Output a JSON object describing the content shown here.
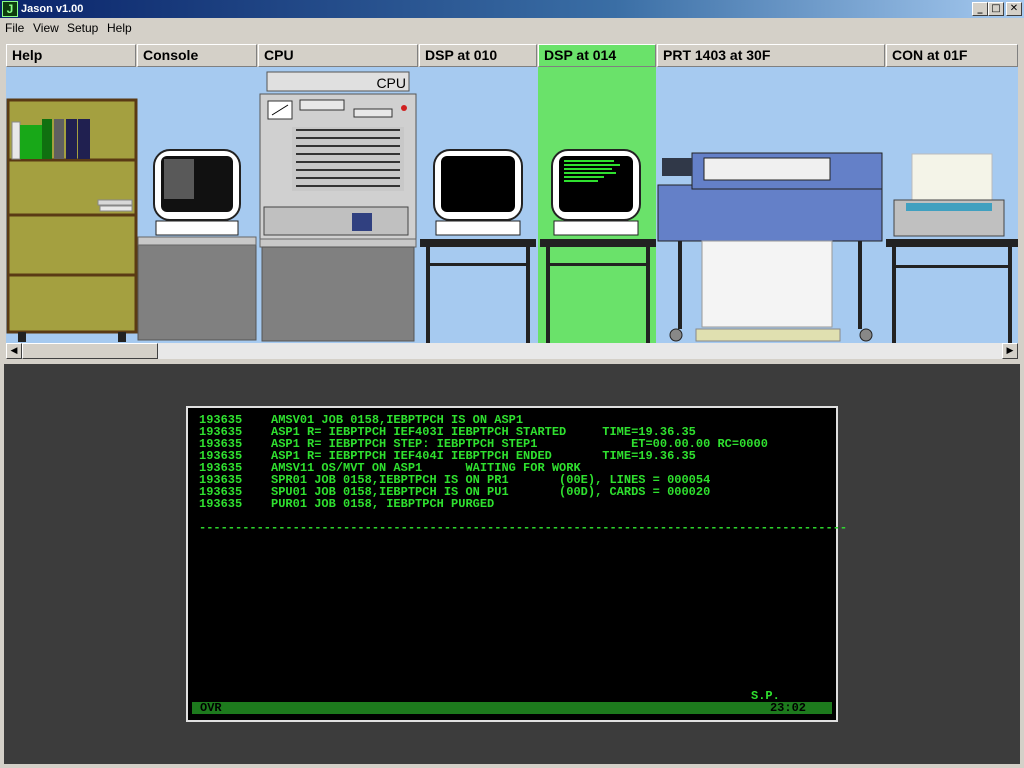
{
  "window": {
    "title": "Jason v1.00",
    "app_icon_glyph": "J",
    "minimize": "_",
    "maximize": "□",
    "close": "✕"
  },
  "menu": {
    "items": [
      "File",
      "View",
      "Setup",
      "Help"
    ]
  },
  "tabs": [
    {
      "label": "Help"
    },
    {
      "label": "Console"
    },
    {
      "label": "CPU"
    },
    {
      "label": "DSP at 010"
    },
    {
      "label": "DSP at 014",
      "active": true
    },
    {
      "label": "PRT 1403 at 30F"
    },
    {
      "label": "CON at 01F"
    }
  ],
  "machine_room": {
    "cpu_label": "CPU"
  },
  "scrollbar": {
    "left_arrow": "◀",
    "right_arrow": "▶"
  },
  "terminal": {
    "lines": [
      "193635    AMSV01 JOB 0158,IEBPTPCH IS ON ASP1",
      "193635    ASP1 R= IEBPTPCH IEF403I IEBPTPCH STARTED     TIME=19.36.35",
      "193635    ASP1 R= IEBPTPCH STEP: IEBPTPCH STEP1             ET=00.00.00 RC=0000",
      "193635    ASP1 R= IEBPTPCH IEF404I IEBPTPCH ENDED       TIME=19.36.35",
      "193635    AMSV11 OS/MVT ON ASP1      WAITING FOR WORK",
      "193635    SPR01 JOB 0158,IEBPTPCH IS ON PR1       (00E), LINES = 000054",
      "193635    SPU01 JOB 0158,IEBPTPCH IS ON PU1       (00D), CARDS = 000020",
      "193635    PUR01 JOB 0158, IEBPTPCH PURGED"
    ],
    "separator": "------------------------------------------------------------------------------------------",
    "sp_label": "S.P.",
    "mode": "OVR",
    "clock": "23:02"
  }
}
